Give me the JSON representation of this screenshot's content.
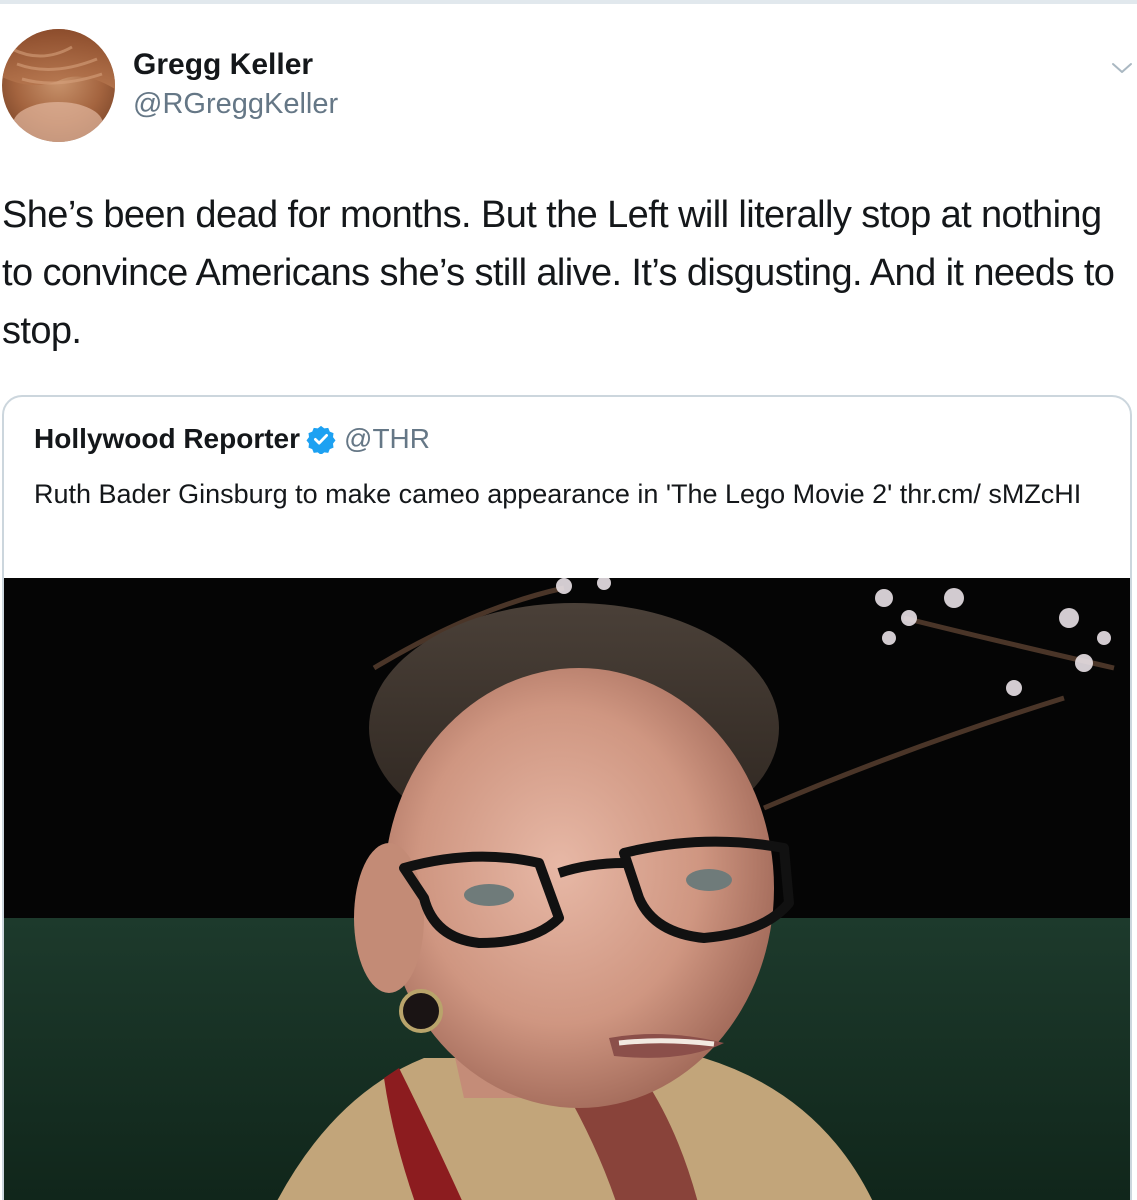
{
  "tweet": {
    "author": {
      "name": "Gregg Keller",
      "handle": "@RGreggKeller"
    },
    "menu_icon": "chevron-down-icon",
    "text": "She’s been dead for months. But the Left will literally stop at nothing to convince Americans she’s still alive. It’s disgusting. And it needs to stop."
  },
  "quoted_tweet": {
    "author": {
      "name": "Hollywood Reporter",
      "handle": "@THR",
      "verified_icon": "verified-badge-icon"
    },
    "text": "Ruth Bader Ginsburg to make cameo appearance in 'The Lego Movie 2' thr.cm/ sMZcHI"
  },
  "colors": {
    "text_primary": "#14171a",
    "text_secondary": "#657786",
    "border": "#ccd6dd",
    "verified_blue": "#1da1f2"
  }
}
